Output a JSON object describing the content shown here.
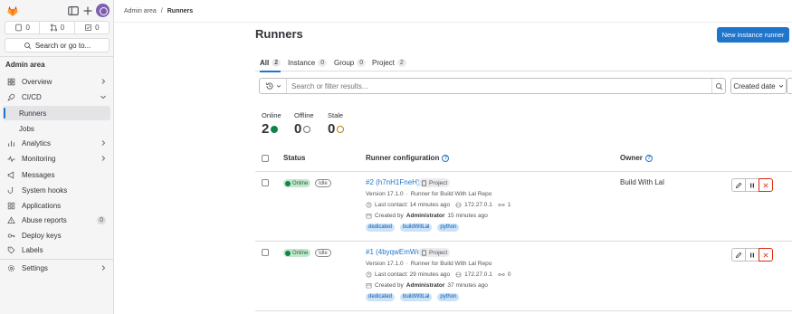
{
  "sidebar": {
    "counts": [
      "0",
      "0",
      "0"
    ],
    "search_label": "Search or go to...",
    "section_title": "Admin area",
    "items": [
      {
        "label": "Overview",
        "icon": "overview-icon",
        "chevron": true
      },
      {
        "label": "CI/CD",
        "icon": "rocket-icon",
        "chevron": true,
        "expanded": true
      },
      {
        "label": "Runners",
        "sub": true,
        "active": true
      },
      {
        "label": "Jobs",
        "sub": true
      },
      {
        "label": "Analytics",
        "icon": "chart-icon",
        "chevron": true
      },
      {
        "label": "Monitoring",
        "icon": "monitor-icon",
        "chevron": true
      },
      {
        "label": "Messages",
        "icon": "megaphone-icon"
      },
      {
        "label": "System hooks",
        "icon": "hook-icon"
      },
      {
        "label": "Applications",
        "icon": "applications-icon"
      },
      {
        "label": "Abuse reports",
        "icon": "warning-icon",
        "badge": "0"
      },
      {
        "label": "Deploy keys",
        "icon": "key-icon"
      },
      {
        "label": "Labels",
        "icon": "label-icon"
      },
      {
        "label": "Settings",
        "icon": "gear-icon",
        "chevron": true
      }
    ]
  },
  "breadcrumb": {
    "parent": "Admin area",
    "separator": "/",
    "current": "Runners"
  },
  "page": {
    "title": "Runners",
    "new_button": "New instance runner"
  },
  "tabs": [
    {
      "label": "All",
      "count": "2",
      "active": true
    },
    {
      "label": "Instance",
      "count": "0"
    },
    {
      "label": "Group",
      "count": "0"
    },
    {
      "label": "Project",
      "count": "2"
    }
  ],
  "filter": {
    "placeholder": "Search or filter results...",
    "sort_label": "Created date"
  },
  "stats": {
    "online": {
      "label": "Online",
      "value": "2"
    },
    "offline": {
      "label": "Offline",
      "value": "0"
    },
    "stale": {
      "label": "Stale",
      "value": "0"
    }
  },
  "table": {
    "headers": {
      "status": "Status",
      "config": "Runner configuration",
      "owner": "Owner"
    },
    "rows": [
      {
        "status": "Online",
        "state": "Idle",
        "name": "#2 (h7nH1FneH)",
        "type": "Project",
        "version": "Version 17.1.0",
        "sep": "·",
        "description": "Runner for Build With Lal Repo",
        "last_contact": "Last contact: 14 minutes ago",
        "ip": "172.27.0.1",
        "jobs": "1",
        "created_prefix": "Created by",
        "created_by": "Administrator",
        "created_ago": "15 minutes ago",
        "tags": [
          "dedicated",
          "buildWitLal",
          "python"
        ],
        "owner": "Build With Lal"
      },
      {
        "status": "Online",
        "state": "Idle",
        "name": "#1 (4byqwEmWq)",
        "type": "Project",
        "version": "Version 17.1.0",
        "sep": "·",
        "description": "Runner for Build With Lal Repo",
        "last_contact": "Last contact: 29 minutes ago",
        "ip": "172.27.0.1",
        "jobs": "0",
        "created_prefix": "Created by",
        "created_by": "Administrator",
        "created_ago": "37 minutes ago",
        "tags": [
          "dedicated",
          "buildWitLal",
          "python"
        ],
        "owner": ""
      }
    ]
  },
  "colors": {
    "accent": "#1f75cb",
    "online": "#108548",
    "danger": "#dd2b0e",
    "stale": "#c17d10"
  }
}
